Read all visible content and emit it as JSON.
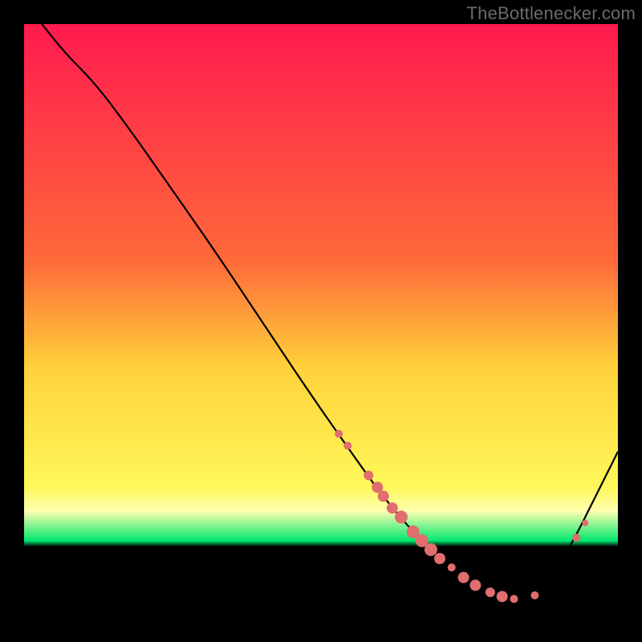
{
  "watermark": "TheBottlenecker.com",
  "colors": {
    "top": "#ff1a4e",
    "upper": "#ff6a3a",
    "mid": "#ffd23a",
    "lower": "#fff85a",
    "pale_yellow": "#ffffb0",
    "green": "#00e870",
    "curve": "#000000",
    "frame": "#000000",
    "dot": "#e06e6e"
  },
  "chart_data": {
    "type": "line",
    "title": "",
    "xlabel": "",
    "ylabel": "",
    "xlim": [
      0,
      100
    ],
    "ylim": [
      0,
      100
    ],
    "gradient_bands": [
      {
        "x": 0,
        "color_key": "top"
      },
      {
        "x": 40,
        "color_key": "upper"
      },
      {
        "x": 58,
        "color_key": "mid"
      },
      {
        "x": 78,
        "color_key": "lower"
      },
      {
        "x": 82,
        "color_key": "pale_yellow"
      },
      {
        "x": 87,
        "color_key": "green"
      },
      {
        "x": 88,
        "color_key": "frame"
      }
    ],
    "curve": [
      {
        "x": 3,
        "y": 100
      },
      {
        "x": 7,
        "y": 95
      },
      {
        "x": 12,
        "y": 90
      },
      {
        "x": 18,
        "y": 82
      },
      {
        "x": 25,
        "y": 72
      },
      {
        "x": 32,
        "y": 62
      },
      {
        "x": 40,
        "y": 50
      },
      {
        "x": 48,
        "y": 38
      },
      {
        "x": 55,
        "y": 28
      },
      {
        "x": 60,
        "y": 21
      },
      {
        "x": 65,
        "y": 15
      },
      {
        "x": 70,
        "y": 10
      },
      {
        "x": 75,
        "y": 6
      },
      {
        "x": 80,
        "y": 3.5
      },
      {
        "x": 84,
        "y": 3
      },
      {
        "x": 88,
        "y": 6
      },
      {
        "x": 92,
        "y": 12
      },
      {
        "x": 96,
        "y": 20
      },
      {
        "x": 100,
        "y": 28
      }
    ],
    "dots": [
      {
        "x": 53,
        "y": 31,
        "r": 5
      },
      {
        "x": 54.5,
        "y": 29,
        "r": 5
      },
      {
        "x": 58,
        "y": 24,
        "r": 6
      },
      {
        "x": 59.5,
        "y": 22,
        "r": 7
      },
      {
        "x": 60.5,
        "y": 20.5,
        "r": 7
      },
      {
        "x": 62,
        "y": 18.5,
        "r": 7
      },
      {
        "x": 63.5,
        "y": 17,
        "r": 8
      },
      {
        "x": 65.5,
        "y": 14.5,
        "r": 8
      },
      {
        "x": 67,
        "y": 13,
        "r": 8
      },
      {
        "x": 68.5,
        "y": 11.5,
        "r": 8
      },
      {
        "x": 70,
        "y": 10,
        "r": 7
      },
      {
        "x": 72,
        "y": 8.5,
        "r": 5
      },
      {
        "x": 74,
        "y": 6.8,
        "r": 7
      },
      {
        "x": 76,
        "y": 5.5,
        "r": 7
      },
      {
        "x": 78.5,
        "y": 4.3,
        "r": 6
      },
      {
        "x": 80.5,
        "y": 3.6,
        "r": 7
      },
      {
        "x": 82.5,
        "y": 3.2,
        "r": 5
      },
      {
        "x": 86,
        "y": 3.8,
        "r": 5
      },
      {
        "x": 93,
        "y": 13.5,
        "r": 5
      },
      {
        "x": 94.5,
        "y": 16,
        "r": 4
      }
    ]
  }
}
